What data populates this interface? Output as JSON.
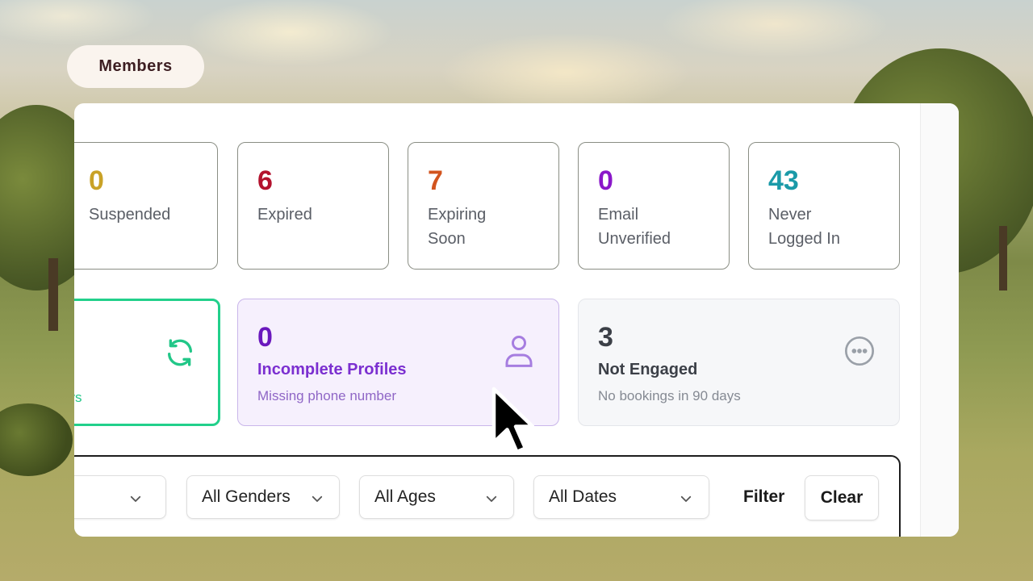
{
  "header": {
    "title": "Members"
  },
  "stats": [
    {
      "value": "0",
      "label": "Suspended",
      "color": "#c9a227"
    },
    {
      "value": "6",
      "label": "Expired",
      "color": "#b3122e"
    },
    {
      "value": "7",
      "label": "Expiring Soon",
      "color": "#d2541e"
    },
    {
      "value": "0",
      "label": "Email Unverified",
      "color": "#8a17c9"
    },
    {
      "value": "43",
      "label": "Never Logged In",
      "color": "#1a9aa8"
    }
  ],
  "highlights": [
    {
      "subtitle_fragment": "ays",
      "accent": "#22d08b",
      "icon": "refresh-icon"
    },
    {
      "value": "0",
      "title": "Incomplete Profiles",
      "subtitle": "Missing phone number",
      "accent": "#7b2fd0",
      "icon": "user-icon"
    },
    {
      "value": "3",
      "title": "Not Engaged",
      "subtitle": "No bookings in 90 days",
      "accent": "#3b3f47",
      "icon": "more-circle-icon"
    }
  ],
  "filters": {
    "first_value": "",
    "gender": "All Genders",
    "age": "All Ages",
    "date": "All Dates",
    "filter_label": "Filter",
    "clear_label": "Clear"
  }
}
